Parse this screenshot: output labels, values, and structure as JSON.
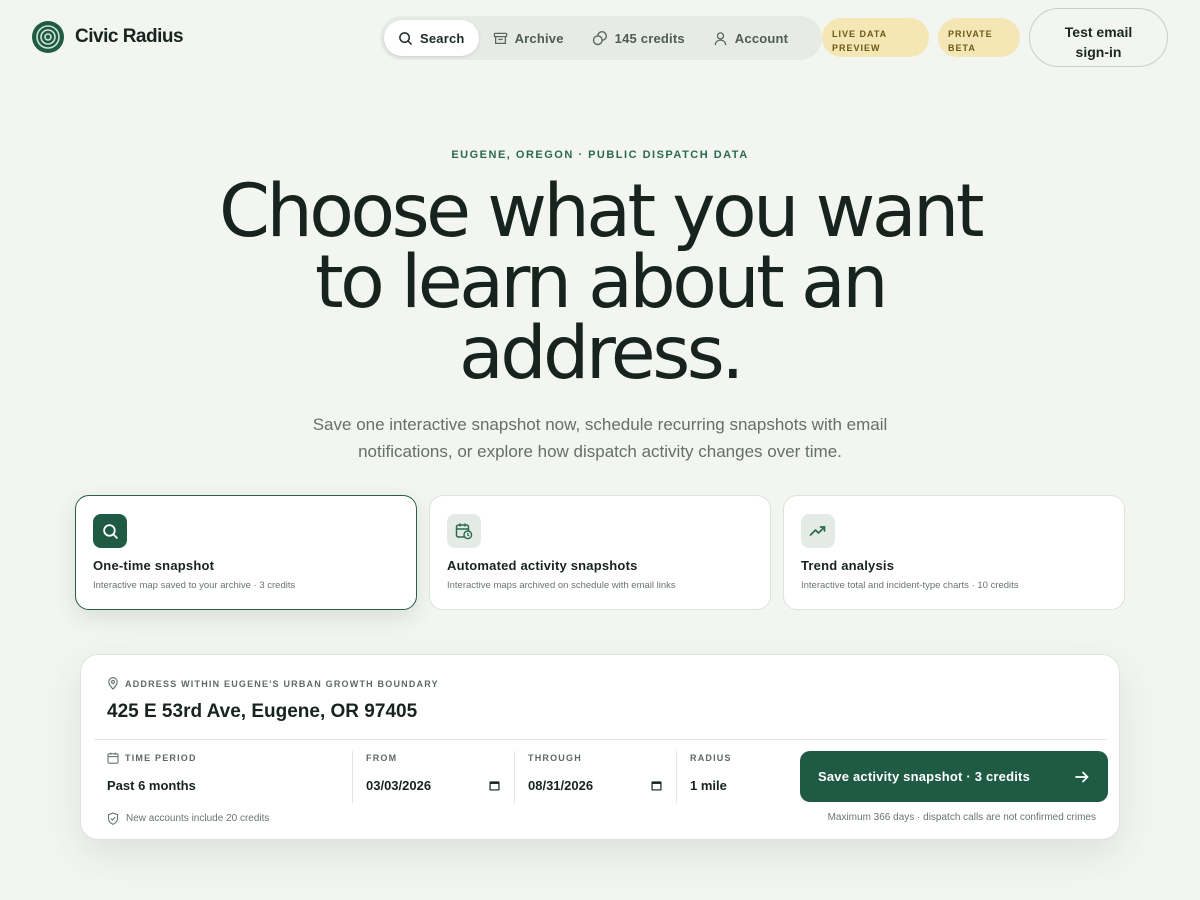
{
  "brand": {
    "name": "Civic Radius",
    "logo_icon": "concentric-circles-icon",
    "accent": "#1f5a45"
  },
  "nav": {
    "items": [
      {
        "label": "Search",
        "icon": "search-icon",
        "active": true
      },
      {
        "label": "Archive",
        "icon": "archive-icon",
        "active": false
      },
      {
        "label": "145 credits",
        "icon": "coins-icon",
        "active": false
      },
      {
        "label": "Account",
        "icon": "user-icon",
        "active": false
      }
    ]
  },
  "badges": {
    "live": "LIVE DATA PREVIEW",
    "beta": "PRIVATE BETA",
    "color": "#f5e6b6"
  },
  "signin_label": "Test email sign-in",
  "hero": {
    "eyebrow": "EUGENE, OREGON · PUBLIC DISPATCH DATA",
    "title": "Choose what you want to learn about an address.",
    "subtitle": "Save one interactive snapshot now, schedule recurring snapshots with email notifications, or explore how dispatch activity changes over time."
  },
  "options": [
    {
      "title": "One-time snapshot",
      "desc": "Interactive map saved to your archive · 3 credits",
      "icon": "search-icon",
      "selected": true
    },
    {
      "title": "Automated activity snapshots",
      "desc": "Interactive maps archived on schedule with email links",
      "icon": "calendar-clock-icon",
      "selected": false
    },
    {
      "title": "Trend analysis",
      "desc": "Interactive total and incident-type charts · 10 credits",
      "icon": "trending-up-icon",
      "selected": false
    }
  ],
  "search": {
    "address_label": "ADDRESS WITHIN EUGENE'S URBAN GROWTH BOUNDARY",
    "address_value": "425 E 53rd Ave, Eugene, OR 97405",
    "period_label": "TIME PERIOD",
    "period_value": "Past 6 months",
    "from_label": "FROM",
    "from_value": "03/03/2026",
    "through_label": "THROUGH",
    "through_value": "08/31/2026",
    "radius_label": "RADIUS",
    "radius_value": "1 mile",
    "save_label": "Save activity snapshot · 3 credits",
    "note_left": "New accounts include 20 credits",
    "note_right": "Maximum 366 days · dispatch calls are not confirmed crimes"
  }
}
